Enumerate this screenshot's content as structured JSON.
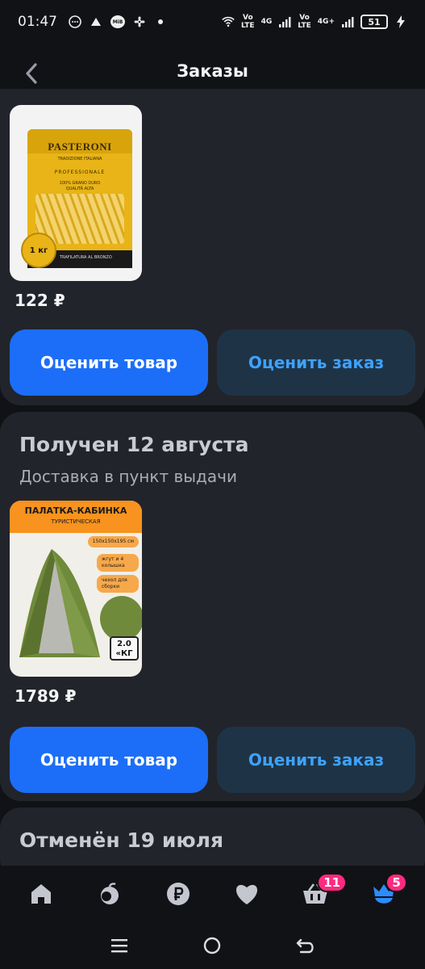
{
  "status_bar": {
    "time": "01:47",
    "net1_top": "Vo",
    "net1_bottom": "LTE",
    "net1_gen": "4G",
    "net2_top": "Vo",
    "net2_bottom": "LTE",
    "net2_gen": "4G+",
    "battery": "51",
    "small_badge": "MiB"
  },
  "header": {
    "title": "Заказы"
  },
  "orders": [
    {
      "product": {
        "brand": "PASTERONI",
        "line1": "TRADIZIONE ITALIANA",
        "line2": "PROFESSIONALE",
        "line3": "100% GRANO DURO",
        "line4": "QUALITÀ ALTA",
        "band": "TRAFILATURA AL BRONZO",
        "weight": "1 кг"
      },
      "price": "122 ₽",
      "rate_product_label": "Оценить товар",
      "rate_order_label": "Оценить заказ"
    },
    {
      "status": "Получен 12 августа",
      "delivery": "Доставка в пункт выдачи",
      "product": {
        "banner_title": "ПАЛАТКА-КАБИНКА",
        "banner_sub": "ТУРИСТИЧЕСКАЯ",
        "chip1": "150x150x195 см",
        "chip2": "жгут и 4 колышка",
        "chip3": "чехол для сборки",
        "weight_value": "2.0",
        "weight_unit": "«КГ"
      },
      "price": "1789 ₽",
      "rate_product_label": "Оценить товар",
      "rate_order_label": "Оценить заказ"
    },
    {
      "status": "Отменён 19 июля"
    }
  ],
  "bottom_nav": {
    "items": [
      {
        "icon": "home-icon"
      },
      {
        "icon": "catalog-icon"
      },
      {
        "icon": "ruble-icon"
      },
      {
        "icon": "heart-icon"
      },
      {
        "icon": "cart-icon",
        "badge": "11"
      },
      {
        "icon": "profile-icon",
        "badge": "5"
      }
    ],
    "active_color": "#2d8cff",
    "badge_color": "#ff2a7f"
  },
  "colors": {
    "background": "#111216",
    "card": "#22242b",
    "primary_button": "#1c6ef8",
    "secondary_button": "#1e3446",
    "secondary_button_text": "#3ea2ff"
  }
}
